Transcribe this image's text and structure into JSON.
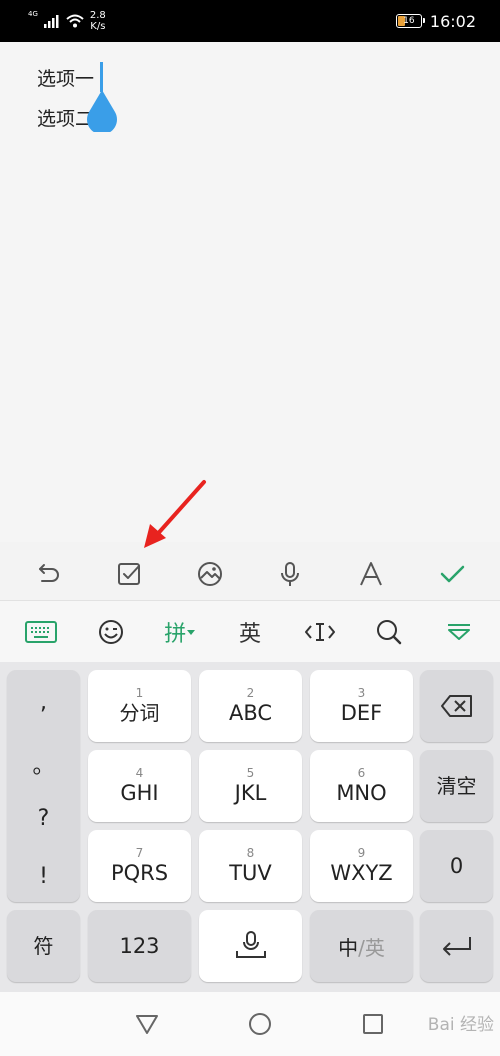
{
  "status_bar": {
    "network_type": "4G",
    "speed_value": "2.8",
    "speed_unit": "K/s",
    "battery_level": "16",
    "time": "16:02",
    "colors": {
      "background": "#000000",
      "battery_fill": "#e8a13a"
    }
  },
  "note": {
    "lines": [
      "选项一",
      "选项二"
    ],
    "cursor_color": "#3a9ee8"
  },
  "editor_toolbar": {
    "icons": [
      "undo-icon",
      "checkbox-icon",
      "image-icon",
      "microphone-icon",
      "text-format-icon",
      "done-check-icon"
    ],
    "accent": "#29a36a"
  },
  "keyboard": {
    "top_bar": {
      "pinyin_label": "拼",
      "english_label": "英",
      "icons": [
        "keyboard-icon",
        "emoji-icon",
        "pinyin-dropdown-icon",
        "cursor-move-icon",
        "search-icon",
        "collapse-icon"
      ]
    },
    "punctuation": [
      ",",
      "。",
      "?",
      "!"
    ],
    "keys": [
      {
        "num": "1",
        "label": "分词"
      },
      {
        "num": "2",
        "label": "ABC"
      },
      {
        "num": "3",
        "label": "DEF"
      },
      {
        "num": "4",
        "label": "GHI"
      },
      {
        "num": "5",
        "label": "JKL"
      },
      {
        "num": "6",
        "label": "MNO"
      },
      {
        "num": "7",
        "label": "PQRS"
      },
      {
        "num": "8",
        "label": "TUV"
      },
      {
        "num": "9",
        "label": "WXYZ"
      }
    ],
    "clear_label": "清空",
    "zero_label": "0",
    "symbol_label": "符",
    "numeric_label": "123",
    "zh_label": "中",
    "en_label": "英",
    "separator": "/"
  },
  "nav_bar": {
    "icons": [
      "back-triangle-icon",
      "home-circle-icon",
      "recents-square-icon"
    ],
    "watermark": "Bai 经验"
  }
}
